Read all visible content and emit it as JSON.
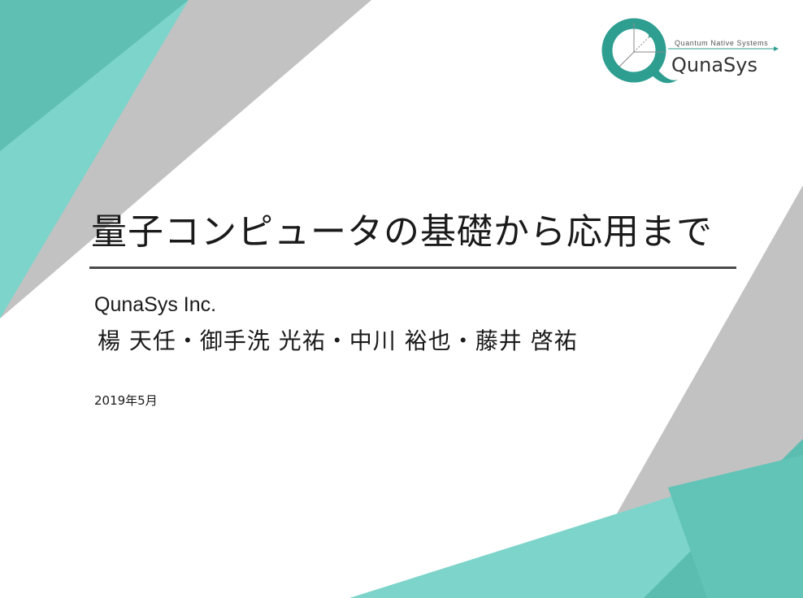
{
  "slide": {
    "title": "量子コンピュータの基礎から応用まで",
    "company": "QunaSys Inc.",
    "authors": "楊 天任・御手洗 光祐・中川 裕也・藤井 啓祐",
    "date": "2019年5月"
  },
  "logo": {
    "tagline": "Quantum Native Systems",
    "wordmark": "QunaSys",
    "brand_color": "#2e9e91"
  },
  "colors": {
    "teal_light": "#76d3c8",
    "teal_mid": "#5bbcb0",
    "teal_dark": "#4faa9f",
    "gray": "#bfbfbf",
    "rule": "#4a4a4a"
  }
}
